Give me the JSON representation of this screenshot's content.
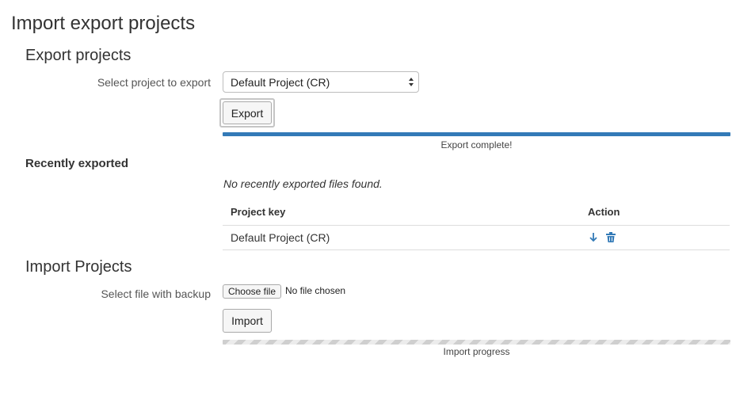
{
  "page_title": "Import export projects",
  "export_section": {
    "title": "Export projects",
    "select_label": "Select project to export",
    "selected_project": "Default Project (CR)",
    "export_button": "Export",
    "progress_percent": 100,
    "progress_status": "Export complete!"
  },
  "recent_section": {
    "title": "Recently exported",
    "empty_message": "No recently exported files found.",
    "columns": [
      "Project key",
      "Action"
    ],
    "rows": [
      {
        "project_key": "Default Project (CR)",
        "actions": [
          "download-icon",
          "trash-icon"
        ]
      }
    ]
  },
  "import_section": {
    "title": "Import Projects",
    "file_label": "Select file with backup",
    "choose_file_button": "Choose file",
    "file_status": "No file chosen",
    "import_button": "Import",
    "progress_label": "Import progress"
  },
  "colors": {
    "accent": "#337ab7",
    "text": "#333333"
  }
}
